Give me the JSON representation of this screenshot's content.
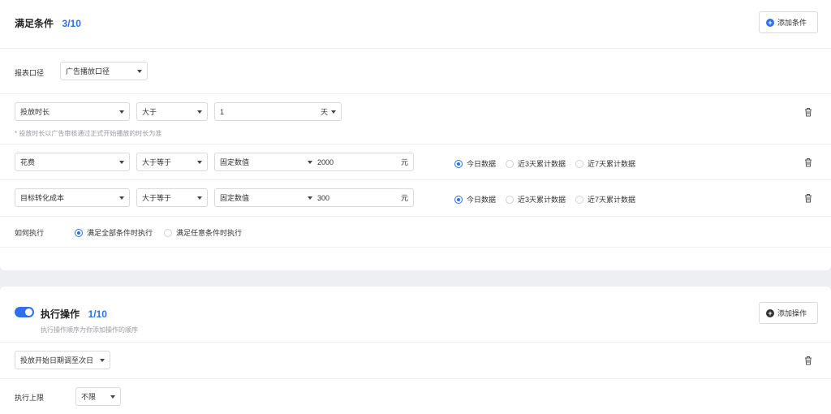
{
  "colors": {
    "accent": "#2f6fed",
    "icon_dark": "#333333"
  },
  "conditions": {
    "title": "满足条件",
    "count_current": "3",
    "count_total": "/10",
    "add_button": "添加条件",
    "report_label": "报表口径",
    "report_value": "广告播放口径",
    "rows": [
      {
        "field": "投放时长",
        "operator": "大于",
        "value": "1",
        "unit": "天",
        "hint": "* 投放时长以广告审核通过正式开始播放的时长为准"
      },
      {
        "field": "花费",
        "operator": "大于等于",
        "value_type": "固定数值",
        "value": "2000",
        "unit": "元",
        "radios": [
          "今日数据",
          "近3天累计数据",
          "近7天累计数据"
        ],
        "selected": 0
      },
      {
        "field": "目标转化成本",
        "operator": "大于等于",
        "value_type": "固定数值",
        "value": "300",
        "unit": "元",
        "radios": [
          "今日数据",
          "近3天累计数据",
          "近7天累计数据"
        ],
        "selected": 0
      }
    ],
    "execute_label": "如何执行",
    "execute_options": [
      "满足全部条件时执行",
      "满足任意条件时执行"
    ],
    "execute_selected": 0
  },
  "actions": {
    "title": "执行操作",
    "count_current": "1",
    "count_total": "/10",
    "enabled": true,
    "subtitle": "执行操作顺序为你添加操作的顺序",
    "add_button": "添加操作",
    "action_value": "投放开始日期调至次日",
    "limit_label": "执行上限",
    "limit_value": "不限"
  }
}
